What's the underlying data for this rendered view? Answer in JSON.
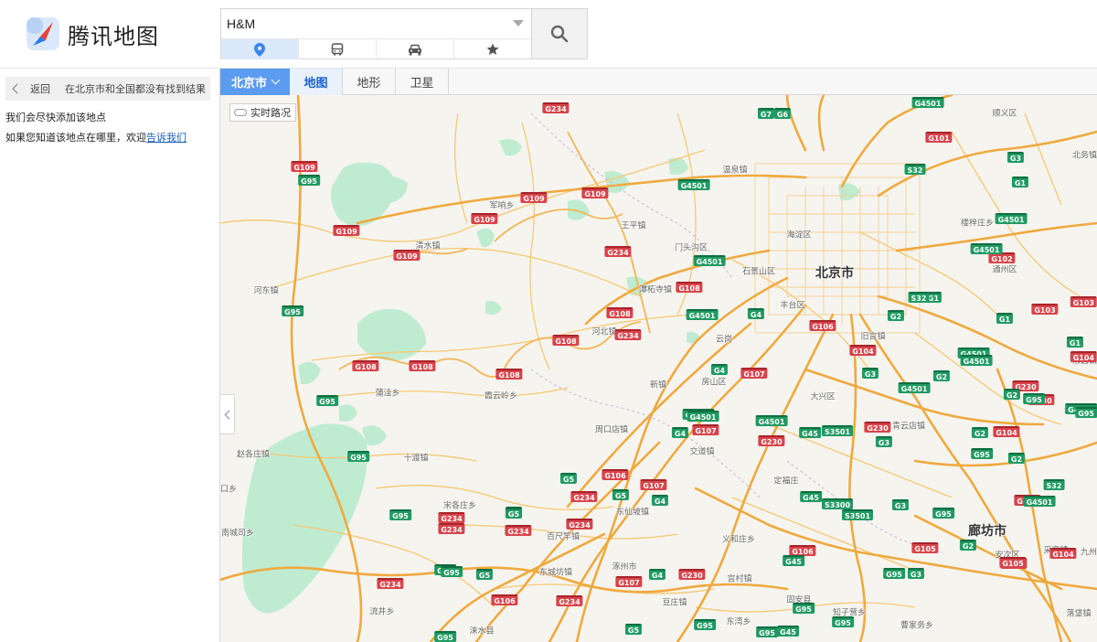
{
  "header": {
    "logo_text": "腾讯地图",
    "search_value": "H&M",
    "modes": [
      {
        "name": "place",
        "icon": "map-pin-icon"
      },
      {
        "name": "bus",
        "icon": "bus-icon"
      },
      {
        "name": "drive",
        "icon": "car-icon"
      },
      {
        "name": "favorite",
        "icon": "star-icon"
      }
    ]
  },
  "left_panel": {
    "back_label": "返回",
    "no_result_text": "在北京市和全国都没有找到结果",
    "msg1": "我们会尽快添加该地点",
    "msg2_prefix": "如果您知道该地点在哪里，欢迎",
    "msg2_link": "告诉我们"
  },
  "toolbar": {
    "city": "北京市",
    "tabs": [
      "地图",
      "地形",
      "卫星"
    ]
  },
  "map": {
    "traffic_label": "实时路况",
    "place_labels": [
      {
        "text": "北京市",
        "big": true
      },
      {
        "text": "廊坊市",
        "big": true
      },
      {
        "text": "海淀区"
      },
      {
        "text": "门头沟区"
      },
      {
        "text": "石景山区"
      },
      {
        "text": "丰台区"
      },
      {
        "text": "房山区"
      },
      {
        "text": "大兴区"
      },
      {
        "text": "顺义区"
      },
      {
        "text": "通州区"
      },
      {
        "text": "涿州市"
      },
      {
        "text": "固安县"
      },
      {
        "text": "涞水县"
      },
      {
        "text": "安次区"
      },
      {
        "text": "河东镇"
      },
      {
        "text": "清水镇"
      },
      {
        "text": "军响乡"
      },
      {
        "text": "王平镇"
      },
      {
        "text": "潭柘寺镇"
      },
      {
        "text": "河北镇"
      },
      {
        "text": "蒲洼乡"
      },
      {
        "text": "霞云岭乡"
      },
      {
        "text": "十渡镇"
      },
      {
        "text": "周口店镇"
      },
      {
        "text": "交道镇"
      },
      {
        "text": "云岗"
      },
      {
        "text": "新镇"
      },
      {
        "text": "赵各庄镇"
      },
      {
        "text": "宋各庄乡"
      },
      {
        "text": "东仙坡镇"
      },
      {
        "text": "百尺竿镇"
      },
      {
        "text": "东城坊镇"
      },
      {
        "text": "豆庄镇"
      },
      {
        "text": "宫村镇"
      },
      {
        "text": "义和庄乡"
      },
      {
        "text": "东湾乡"
      },
      {
        "text": "知子营乡"
      },
      {
        "text": "定福庄"
      },
      {
        "text": "旧宫镇"
      },
      {
        "text": "青云店镇"
      },
      {
        "text": "采育镇"
      },
      {
        "text": "九州"
      },
      {
        "text": "温泉镇"
      },
      {
        "text": "楼梓庄乡"
      },
      {
        "text": "北务镇"
      },
      {
        "text": "漷县镇"
      },
      {
        "text": "永乐店镇"
      },
      {
        "text": "码头镇"
      },
      {
        "text": "落垡镇"
      },
      {
        "text": "曹家务乡"
      },
      {
        "text": "流井乡"
      },
      {
        "text": "南城司乡"
      },
      {
        "text": "口乡"
      }
    ],
    "road_shields": [
      {
        "text": "G234",
        "c": "red"
      },
      {
        "text": "G7",
        "c": "green"
      },
      {
        "text": "G6",
        "c": "green"
      },
      {
        "text": "G4501",
        "c": "green"
      },
      {
        "text": "G101",
        "c": "red"
      },
      {
        "text": "G109",
        "c": "red"
      },
      {
        "text": "G95",
        "c": "green"
      },
      {
        "text": "G4501",
        "c": "green"
      },
      {
        "text": "S32",
        "c": "green"
      },
      {
        "text": "G109",
        "c": "red"
      },
      {
        "text": "G109",
        "c": "red"
      },
      {
        "text": "G109",
        "c": "red"
      },
      {
        "text": "G109",
        "c": "red"
      },
      {
        "text": "G109",
        "c": "red"
      },
      {
        "text": "G234",
        "c": "red"
      },
      {
        "text": "G4501",
        "c": "green"
      },
      {
        "text": "G102",
        "c": "red"
      },
      {
        "text": "G95",
        "c": "green"
      },
      {
        "text": "G108",
        "c": "red"
      },
      {
        "text": "G4501",
        "c": "green"
      },
      {
        "text": "G1",
        "c": "green"
      },
      {
        "text": "G108",
        "c": "red"
      },
      {
        "text": "G4",
        "c": "green"
      },
      {
        "text": "G106",
        "c": "red"
      },
      {
        "text": "G2",
        "c": "green"
      },
      {
        "text": "G108",
        "c": "red"
      },
      {
        "text": "G108",
        "c": "red"
      },
      {
        "text": "G234",
        "c": "red"
      },
      {
        "text": "G104",
        "c": "red"
      },
      {
        "text": "G4501",
        "c": "green"
      },
      {
        "text": "G108",
        "c": "red"
      },
      {
        "text": "G107",
        "c": "red"
      },
      {
        "text": "G4",
        "c": "green"
      },
      {
        "text": "G3",
        "c": "green"
      },
      {
        "text": "G2",
        "c": "green"
      },
      {
        "text": "G4501",
        "c": "green"
      },
      {
        "text": "G230",
        "c": "red"
      },
      {
        "text": "G95",
        "c": "green"
      },
      {
        "text": "G108",
        "c": "red"
      },
      {
        "text": "G95",
        "c": "green"
      },
      {
        "text": "G5",
        "c": "green"
      },
      {
        "text": "G234",
        "c": "red"
      },
      {
        "text": "G106",
        "c": "red"
      },
      {
        "text": "G4501",
        "c": "green"
      },
      {
        "text": "G4501",
        "c": "green"
      },
      {
        "text": "G104",
        "c": "red"
      },
      {
        "text": "G4501",
        "c": "green"
      },
      {
        "text": "G4",
        "c": "green"
      },
      {
        "text": "G107",
        "c": "red"
      },
      {
        "text": "G45",
        "c": "green"
      },
      {
        "text": "S3501",
        "c": "green"
      },
      {
        "text": "G230",
        "c": "red"
      },
      {
        "text": "G3",
        "c": "green"
      },
      {
        "text": "G230",
        "c": "red"
      },
      {
        "text": "G2",
        "c": "green"
      },
      {
        "text": "G95",
        "c": "green"
      },
      {
        "text": "G234",
        "c": "red"
      },
      {
        "text": "G5",
        "c": "green"
      },
      {
        "text": "G5",
        "c": "green"
      },
      {
        "text": "G107",
        "c": "red"
      },
      {
        "text": "G234",
        "c": "red"
      },
      {
        "text": "G4",
        "c": "green"
      },
      {
        "text": "G45",
        "c": "green"
      },
      {
        "text": "S3300",
        "c": "green"
      },
      {
        "text": "G3",
        "c": "green"
      },
      {
        "text": "S3501",
        "c": "green"
      },
      {
        "text": "G95",
        "c": "green"
      },
      {
        "text": "G104",
        "c": "red"
      },
      {
        "text": "G95",
        "c": "green"
      },
      {
        "text": "G234",
        "c": "red"
      },
      {
        "text": "G5",
        "c": "green"
      },
      {
        "text": "G234",
        "c": "red"
      },
      {
        "text": "G106",
        "c": "red"
      },
      {
        "text": "G105",
        "c": "red"
      },
      {
        "text": "G2",
        "c": "green"
      },
      {
        "text": "G95",
        "c": "green"
      },
      {
        "text": "G5",
        "c": "green"
      },
      {
        "text": "G107",
        "c": "red"
      },
      {
        "text": "G4",
        "c": "green"
      },
      {
        "text": "G230",
        "c": "red"
      },
      {
        "text": "G45",
        "c": "green"
      },
      {
        "text": "G95",
        "c": "green"
      },
      {
        "text": "G3",
        "c": "green"
      },
      {
        "text": "G105",
        "c": "red"
      },
      {
        "text": "G104",
        "c": "red"
      },
      {
        "text": "G234",
        "c": "red"
      },
      {
        "text": "G95",
        "c": "green"
      },
      {
        "text": "G106",
        "c": "red"
      },
      {
        "text": "G95",
        "c": "green"
      },
      {
        "text": "G234",
        "c": "red"
      },
      {
        "text": "G5",
        "c": "green"
      },
      {
        "text": "G95",
        "c": "green"
      },
      {
        "text": "G95",
        "c": "green"
      },
      {
        "text": "G95",
        "c": "green"
      },
      {
        "text": "G45",
        "c": "green"
      },
      {
        "text": "G95",
        "c": "green"
      },
      {
        "text": "G105",
        "c": "red"
      },
      {
        "text": "G103",
        "c": "red"
      },
      {
        "text": "G4501",
        "c": "green"
      },
      {
        "text": "G1",
        "c": "green"
      },
      {
        "text": "G103",
        "c": "red"
      },
      {
        "text": "G1",
        "c": "green"
      },
      {
        "text": "G4501",
        "c": "green"
      },
      {
        "text": "G4501",
        "c": "green"
      },
      {
        "text": "G230",
        "c": "red"
      },
      {
        "text": "G95",
        "c": "green"
      },
      {
        "text": "G2",
        "c": "green"
      },
      {
        "text": "G95",
        "c": "green"
      },
      {
        "text": "G2",
        "c": "green"
      },
      {
        "text": "G104",
        "c": "red"
      },
      {
        "text": "S32",
        "c": "green"
      },
      {
        "text": "G4501",
        "c": "green"
      },
      {
        "text": "G1",
        "c": "green"
      },
      {
        "text": "G3",
        "c": "green"
      },
      {
        "text": "G4501",
        "c": "green"
      },
      {
        "text": "S32",
        "c": "green"
      }
    ],
    "colors": {
      "land": "#f5f4ef",
      "forest": "#bfecd1",
      "highway": "#f0a93e",
      "road": "#f7c871",
      "shield_red": "#d9434b",
      "shield_green": "#1f9a62",
      "accent": "#5b9bf0"
    }
  }
}
